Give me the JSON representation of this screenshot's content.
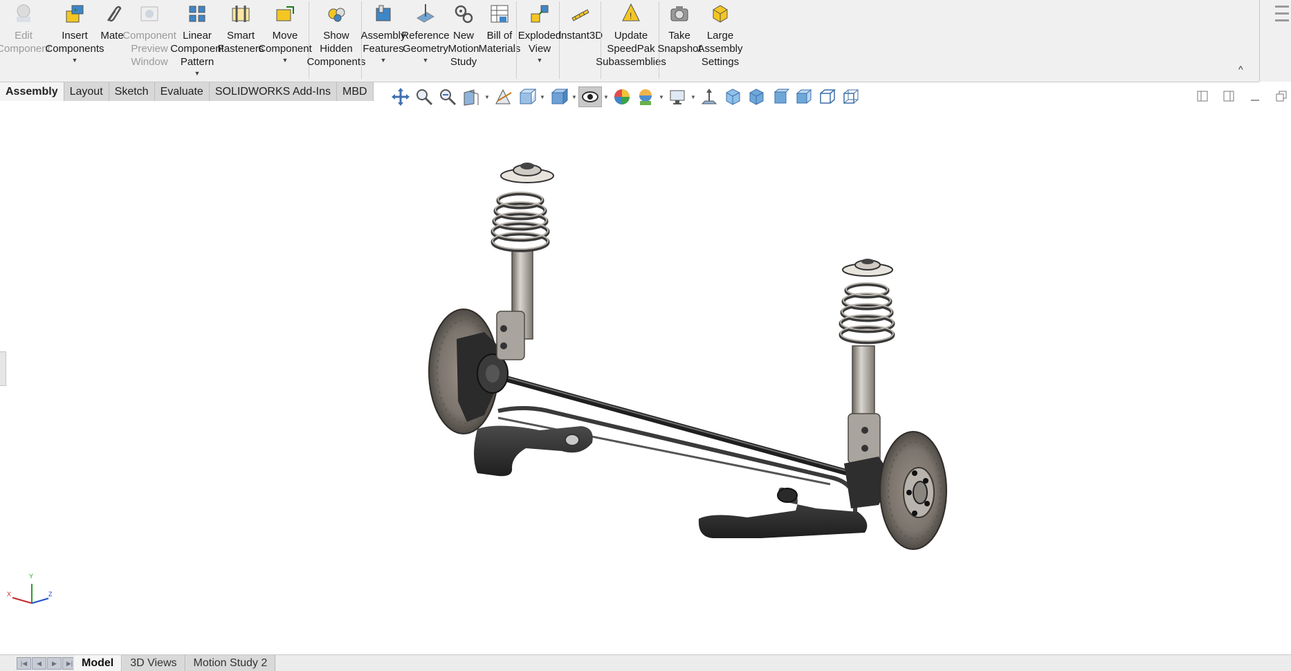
{
  "ribbon": {
    "buttons": [
      {
        "label": "Edit\nComponent",
        "icon": "edit-component-icon",
        "disabled": true,
        "dropdown": false
      },
      {
        "label": "Insert\nComponents",
        "icon": "insert-components-icon",
        "disabled": false,
        "dropdown": true
      },
      {
        "label": "Mate",
        "icon": "mate-paperclip-icon",
        "disabled": false,
        "dropdown": false
      },
      {
        "label": "Component\nPreview\nWindow",
        "icon": "component-preview-icon",
        "disabled": true,
        "dropdown": false
      },
      {
        "label": "Linear\nComponent\nPattern",
        "icon": "linear-pattern-icon",
        "disabled": false,
        "dropdown": true
      },
      {
        "label": "Smart\nFasteners",
        "icon": "smart-fasteners-icon",
        "disabled": false,
        "dropdown": false
      },
      {
        "label": "Move\nComponent",
        "icon": "move-component-icon",
        "disabled": false,
        "dropdown": true
      },
      {
        "label": "Show\nHidden\nComponents",
        "icon": "show-hidden-icon",
        "disabled": false,
        "dropdown": false
      },
      {
        "label": "Assembly\nFeatures",
        "icon": "assembly-features-icon",
        "disabled": false,
        "dropdown": true
      },
      {
        "label": "Reference\nGeometry",
        "icon": "reference-geometry-icon",
        "disabled": false,
        "dropdown": true
      },
      {
        "label": "New\nMotion\nStudy",
        "icon": "motion-study-icon",
        "disabled": false,
        "dropdown": false
      },
      {
        "label": "Bill of\nMaterials",
        "icon": "bill-of-materials-icon",
        "disabled": false,
        "dropdown": false
      },
      {
        "label": "Exploded\nView",
        "icon": "exploded-view-icon",
        "disabled": false,
        "dropdown": true
      },
      {
        "label": "Instant3D",
        "icon": "instant3d-icon",
        "disabled": false,
        "dropdown": false
      },
      {
        "label": "Update\nSpeedPak\nSubassemblies",
        "icon": "speedpak-icon",
        "disabled": false,
        "dropdown": false
      },
      {
        "label": "Take\nSnapshot",
        "icon": "camera-icon",
        "disabled": false,
        "dropdown": false
      },
      {
        "label": "Large\nAssembly\nSettings",
        "icon": "large-assembly-icon",
        "disabled": false,
        "dropdown": false
      }
    ],
    "collapse_glyph": "^"
  },
  "tabs": [
    "Assembly",
    "Layout",
    "Sketch",
    "Evaluate",
    "SOLIDWORKS Add-Ins",
    "MBD"
  ],
  "active_tab": "Assembly",
  "heads_up_icons": [
    "zoom-to-fit-icon",
    "zoom-to-area-icon",
    "previous-view-icon",
    "section-view-icon",
    "dynamic-annotation-icon",
    "view-orientation-icon",
    "display-style-icon",
    "hide-show-items-icon",
    "edit-appearance-icon",
    "apply-scene-icon",
    "view-settings-icon",
    "normal-to-icon",
    "front-view-icon",
    "back-view-icon",
    "right-view-icon",
    "isometric-view-icon",
    "trimetric-view-icon",
    "dimetric-view-icon"
  ],
  "triad": {
    "x": "X",
    "y": "Y",
    "z": "Z"
  },
  "bottom_tabs": [
    "Model",
    "3D Views",
    "Motion Study 2"
  ],
  "active_bottom_tab": "Model"
}
